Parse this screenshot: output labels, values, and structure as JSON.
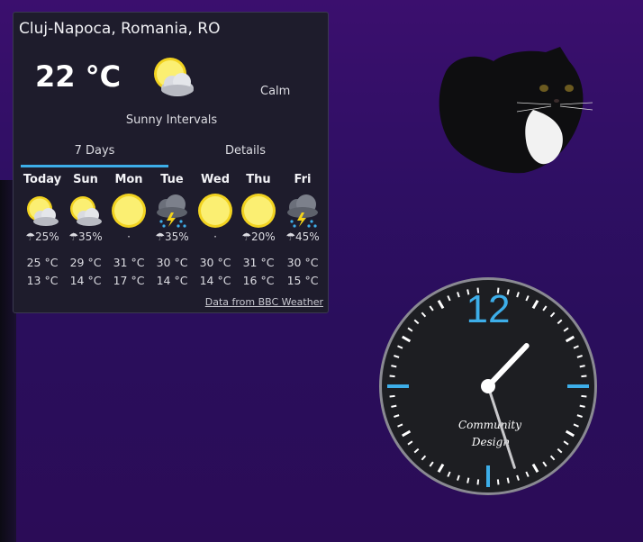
{
  "weather": {
    "location": "Cluj-Napoca, Romania, RO",
    "current_temp": "22 °C",
    "current_icon": "sunny-intervals-icon",
    "wind": "Calm",
    "condition": "Sunny Intervals",
    "tabs": [
      {
        "label": "7 Days",
        "active": true
      },
      {
        "label": "Details",
        "active": false
      }
    ],
    "days": [
      {
        "name": "Today",
        "icon": "sun-cloud-icon",
        "rain": "☂25%",
        "high": "25 °C",
        "low": "13 °C"
      },
      {
        "name": "Sun",
        "icon": "sun-cloud-icon",
        "rain": "☂35%",
        "high": "29 °C",
        "low": "14 °C"
      },
      {
        "name": "Mon",
        "icon": "sun-icon",
        "rain": "·",
        "high": "31 °C",
        "low": "17 °C"
      },
      {
        "name": "Tue",
        "icon": "thunderstorm-icon",
        "rain": "☂35%",
        "high": "30 °C",
        "low": "14 °C"
      },
      {
        "name": "Wed",
        "icon": "sun-icon",
        "rain": "·",
        "high": "30 °C",
        "low": "14 °C"
      },
      {
        "name": "Thu",
        "icon": "sun-icon",
        "rain": "☂20%",
        "high": "31 °C",
        "low": "16 °C"
      },
      {
        "name": "Fri",
        "icon": "thunderstorm-icon",
        "rain": "☂45%",
        "high": "30 °C",
        "low": "15 °C"
      }
    ],
    "credit": "Data from BBC Weather",
    "accent_color": "#3daee9"
  },
  "clock": {
    "twelve_label": "12",
    "brand_line1": "Community",
    "brand_line2": "Design",
    "time": "1:27",
    "accent_color": "#3daee9"
  },
  "desktop": {
    "cat_image": "black-white-cat-image"
  }
}
